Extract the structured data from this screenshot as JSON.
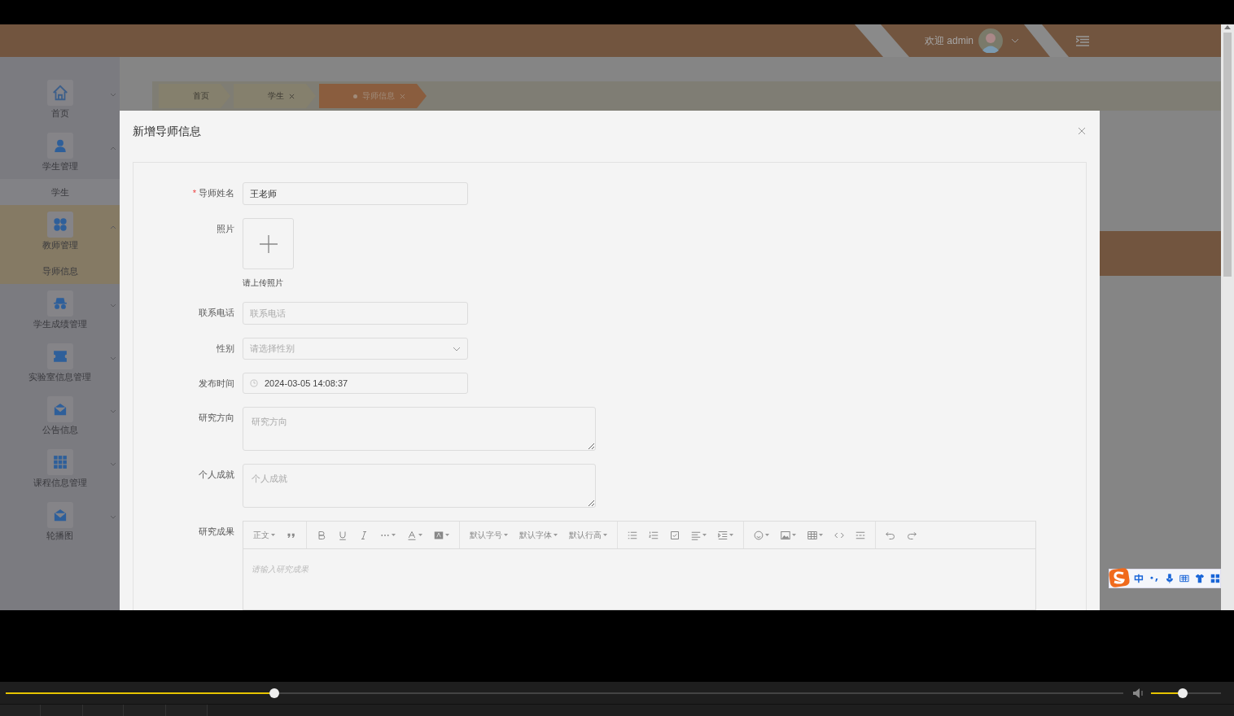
{
  "header": {
    "greeting": "欢迎 admin"
  },
  "breadcrumbs": [
    {
      "label": "首页",
      "selected": false,
      "closable": false
    },
    {
      "label": "学生",
      "selected": false,
      "closable": true
    },
    {
      "label": "导师信息",
      "selected": true,
      "closable": true
    }
  ],
  "sidebar": {
    "items": [
      {
        "label": "首页",
        "expanded": false,
        "selected": false
      },
      {
        "label": "学生管理",
        "expanded": true,
        "selected": false,
        "children": [
          {
            "label": "学生",
            "selected": false
          }
        ]
      },
      {
        "label": "教师管理",
        "expanded": true,
        "selected": true,
        "children": [
          {
            "label": "导师信息",
            "selected": true
          }
        ]
      },
      {
        "label": "学生成绩管理",
        "expanded": false,
        "selected": false
      },
      {
        "label": "实验室信息管理",
        "expanded": false,
        "selected": false
      },
      {
        "label": "公告信息",
        "expanded": false,
        "selected": false
      },
      {
        "label": "课程信息管理",
        "expanded": false,
        "selected": false
      },
      {
        "label": "轮播图",
        "expanded": false,
        "selected": false
      }
    ]
  },
  "dialog": {
    "title": "新增导师信息",
    "fields": [
      {
        "kind": "input",
        "label": "导师姓名",
        "required_mark": "*",
        "value": "王老师"
      },
      {
        "kind": "upload",
        "label": "照片",
        "hint": "请上传照片"
      },
      {
        "kind": "input",
        "label": "联系电话",
        "placeholder": "联系电话"
      },
      {
        "kind": "select",
        "label": "性别",
        "placeholder": "请选择性别"
      },
      {
        "kind": "datetime",
        "label": "发布时间",
        "value": "2024-03-05 14:08:37"
      },
      {
        "kind": "textarea",
        "label": "研究方向",
        "placeholder": "研究方向"
      },
      {
        "kind": "textarea",
        "label": "个人成就",
        "placeholder": "个人成就"
      },
      {
        "kind": "editor",
        "label": "研究成果",
        "placeholder": "请输入研究成果",
        "toolbar_labels": [
          "正文",
          "默认字号",
          "默认字体",
          "默认行高"
        ]
      }
    ]
  },
  "player": {
    "progress": {
      "level": 0.24
    },
    "volume": {
      "level": 0.45
    }
  }
}
